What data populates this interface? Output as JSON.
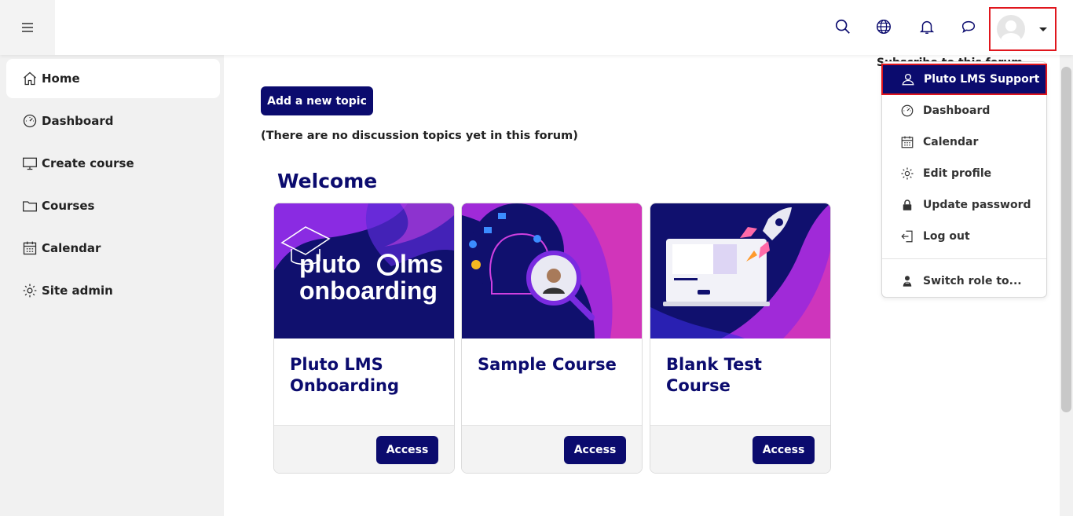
{
  "header": {
    "menu_toggle": "hamburger-icon",
    "icons": [
      "search-icon",
      "globe-icon",
      "bell-icon",
      "chat-icon"
    ],
    "user_avatar": "avatar"
  },
  "sidebar": {
    "items": [
      {
        "label": "Home",
        "icon": "home-icon",
        "active": true
      },
      {
        "label": "Dashboard",
        "icon": "gauge-icon"
      },
      {
        "label": "Create course",
        "icon": "monitor-icon"
      },
      {
        "label": "Courses",
        "icon": "folder-icon"
      },
      {
        "label": "Calendar",
        "icon": "calendar-icon"
      },
      {
        "label": "Site admin",
        "icon": "gear-icon"
      }
    ]
  },
  "main": {
    "add_topic_label": "Add a new topic",
    "no_topics_text": "(There are no discussion topics yet in this forum)",
    "welcome_heading": "Welcome",
    "partially_hidden_text": "Subscribe to this forum",
    "courses": [
      {
        "title": "Pluto LMS Onboarding",
        "access_label": "Access",
        "image_text": [
          "pluto",
          "lms",
          "onboarding"
        ]
      },
      {
        "title": "Sample Course",
        "access_label": "Access"
      },
      {
        "title": "Blank Test Course",
        "access_label": "Access"
      }
    ]
  },
  "user_menu": {
    "items": [
      {
        "label": "Pluto LMS Support",
        "icon": "user-icon",
        "highlighted": true
      },
      {
        "label": "Dashboard",
        "icon": "gauge-icon"
      },
      {
        "label": "Calendar",
        "icon": "calendar-icon"
      },
      {
        "label": "Edit profile",
        "icon": "gear-icon"
      },
      {
        "label": "Update password",
        "icon": "lock-icon"
      },
      {
        "label": "Log out",
        "icon": "logout-icon"
      },
      {
        "label": "Switch role to...",
        "icon": "user-switch-icon"
      }
    ]
  },
  "colors": {
    "primary": "#0b0b6e",
    "highlight_border": "#e0161d",
    "sidebar_bg": "#f1f1f1"
  }
}
